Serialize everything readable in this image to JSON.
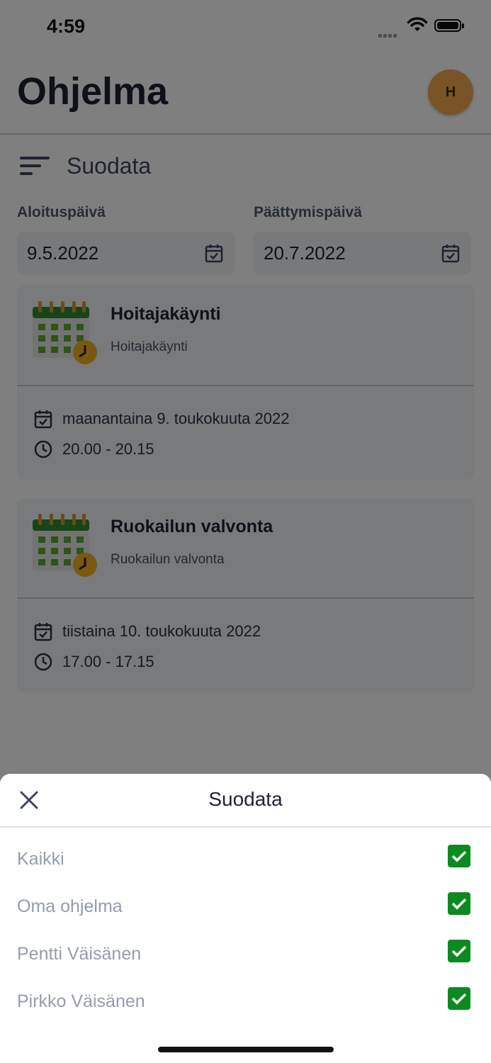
{
  "status_bar": {
    "time": "4:59"
  },
  "header": {
    "title": "Ohjelma",
    "avatar_initial": "H"
  },
  "filter": {
    "label": "Suodata"
  },
  "dates": {
    "start_label": "Aloituspäivä",
    "start_value": "9.5.2022",
    "end_label": "Päättymispäivä",
    "end_value": "20.7.2022"
  },
  "appointments": [
    {
      "title": "Hoitajakäynti",
      "subtitle": "Hoitajakäynti",
      "date": "maanantaina 9. toukokuuta 2022",
      "time": "20.00 - 20.15"
    },
    {
      "title": "Ruokailun valvonta",
      "subtitle": "Ruokailun valvonta",
      "date": "tiistaina 10. toukokuuta 2022",
      "time": "17.00 - 17.15"
    }
  ],
  "sheet": {
    "title": "Suodata",
    "options": [
      {
        "label": "Kaikki",
        "checked": true
      },
      {
        "label": "Oma ohjelma",
        "checked": true
      },
      {
        "label": "Pentti Väisänen",
        "checked": true
      },
      {
        "label": "Pirkko Väisänen",
        "checked": true
      }
    ]
  },
  "colors": {
    "accent_green": "#0d8a1f",
    "avatar_bg": "#f0a84e",
    "overlay": "rgba(0,0,0,0.5)"
  }
}
